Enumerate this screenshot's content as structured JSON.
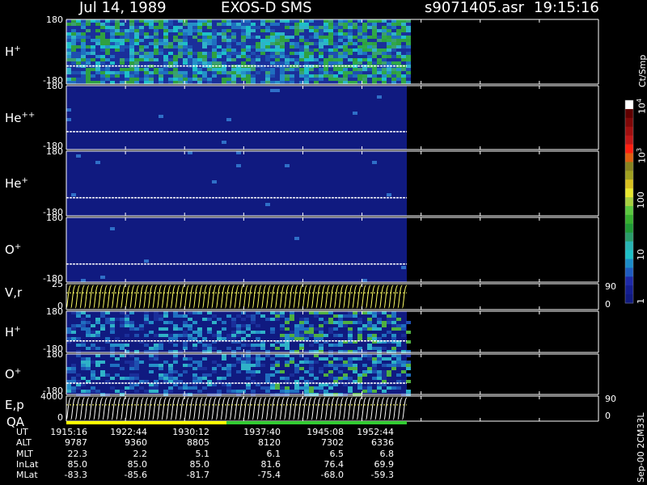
{
  "header": {
    "date": "Jul 14, 1989",
    "instrument": "EXOS-D SMS",
    "file": "s9071405.asr",
    "time": "19:15:16"
  },
  "side_label": "Sep-00  2CM33L",
  "colors": {
    "background": "#000000",
    "frame": "#ffffff",
    "trace": "#ffff66",
    "qa_yellow": "#ffff00",
    "qa_green": "#33cc33",
    "spec_base": "#101a80"
  },
  "chart_data": {
    "type": "heatmap",
    "x_ticks": [
      "1915:16",
      "1922:44",
      "1930:12",
      "1937:40",
      "1945:08",
      "1952:44"
    ],
    "data_extent_label": "1952:44",
    "panels": [
      {
        "label": "H",
        "sup": "+",
        "ymax": "180",
        "ymin": "-180",
        "kind": "spectrogram",
        "intensity": "high"
      },
      {
        "label": "He",
        "sup": "++",
        "ymax": "180",
        "ymin": "-180",
        "kind": "spectrogram",
        "intensity": "low"
      },
      {
        "label": "He",
        "sup": "+",
        "ymax": "180",
        "ymin": "-180",
        "kind": "spectrogram",
        "intensity": "low"
      },
      {
        "label": "O",
        "sup": "+",
        "ymax": "180",
        "ymin": "-180",
        "kind": "spectrogram",
        "intensity": "low"
      },
      {
        "label": "V,r",
        "sup": "",
        "ymax": "25",
        "ymin": "0",
        "right_max": "90",
        "right_min": "0",
        "kind": "trace"
      },
      {
        "label": "H",
        "sup": "+",
        "ymax": "180",
        "ymin": "-180",
        "kind": "spectrogram",
        "intensity": "striped"
      },
      {
        "label": "O",
        "sup": "+",
        "ymax": "180",
        "ymin": "-180",
        "kind": "spectrogram",
        "intensity": "striped"
      },
      {
        "label": "E,p",
        "sup": "",
        "ymax": "4000",
        "ymin": "0",
        "right_max": "90",
        "right_min": "0",
        "kind": "trace",
        "sub_label": "QA"
      }
    ],
    "colorbar": {
      "unit": "Ct/Smp",
      "ticks": [
        {
          "base": "1",
          "exp": ""
        },
        {
          "base": "10",
          "exp": ""
        },
        {
          "base": "100",
          "exp": ""
        },
        {
          "base": "10",
          "exp": "3"
        },
        {
          "base": "10",
          "exp": "4"
        }
      ]
    },
    "ephemeris": {
      "rows": [
        {
          "label": "UT",
          "values": [
            "1915:16",
            "1922:44",
            "1930:12",
            "1937:40",
            "1945:08",
            "1952:44"
          ]
        },
        {
          "label": "ALT",
          "values": [
            "9787",
            "9360",
            "8805",
            "8120",
            "7302",
            "6336"
          ]
        },
        {
          "label": "MLT",
          "values": [
            "22.3",
            "2.2",
            "5.1",
            "6.1",
            "6.5",
            "6.8"
          ]
        },
        {
          "label": "InLat",
          "values": [
            "85.0",
            "85.0",
            "85.0",
            "81.6",
            "76.4",
            "69.9"
          ]
        },
        {
          "label": "MLat",
          "values": [
            "-83.3",
            "-85.6",
            "-81.7",
            "-75.4",
            "-68.0",
            "-59.3"
          ]
        }
      ]
    }
  }
}
